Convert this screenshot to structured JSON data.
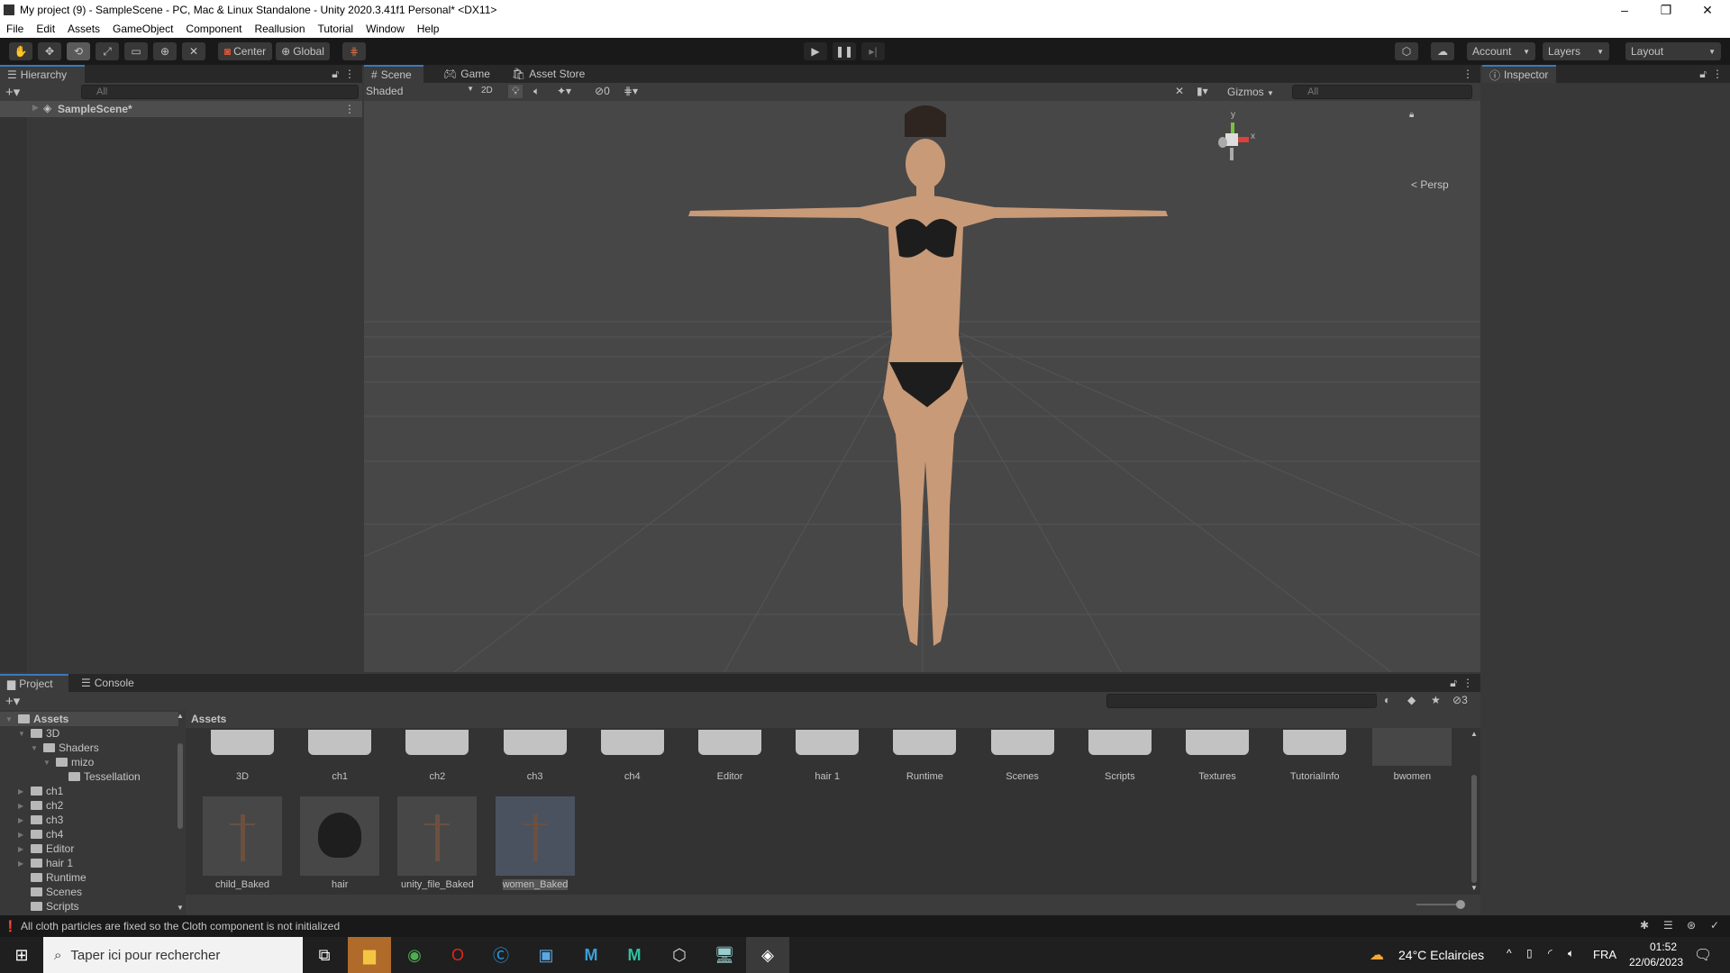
{
  "window": {
    "title": "My project (9) - SampleScene - PC, Mac & Linux Standalone - Unity 2020.3.41f1 Personal* <DX11>"
  },
  "menu": [
    "File",
    "Edit",
    "Assets",
    "GameObject",
    "Component",
    "Reallusion",
    "Tutorial",
    "Window",
    "Help"
  ],
  "toolbar": {
    "pivot": "Center",
    "space": "Global",
    "account": "Account",
    "layers": "Layers",
    "layout": "Layout"
  },
  "hierarchy": {
    "tab": "Hierarchy",
    "search_placeholder": "All",
    "scene": "SampleScene*"
  },
  "scene": {
    "tabs": [
      "Scene",
      "Game",
      "Asset Store"
    ],
    "shading": "Shaded",
    "mode2d": "2D",
    "hidden_count": "0",
    "gizmos": "Gizmos",
    "search_placeholder": "All",
    "projection": "Persp",
    "axis_y": "y",
    "axis_x": "x"
  },
  "inspector": {
    "tab": "Inspector"
  },
  "project": {
    "tabs": [
      "Project",
      "Console"
    ],
    "breadcrumb": "Assets",
    "hidden_count": "3",
    "tree": [
      {
        "label": "Assets",
        "depth": 0,
        "open": true
      },
      {
        "label": "3D",
        "depth": 1,
        "open": true
      },
      {
        "label": "Shaders",
        "depth": 2,
        "open": true
      },
      {
        "label": "mizo",
        "depth": 3,
        "open": true
      },
      {
        "label": "Tessellation",
        "depth": 4
      },
      {
        "label": "ch1",
        "depth": 1,
        "closed": true
      },
      {
        "label": "ch2",
        "depth": 1,
        "closed": true
      },
      {
        "label": "ch3",
        "depth": 1,
        "closed": true
      },
      {
        "label": "ch4",
        "depth": 1,
        "closed": true
      },
      {
        "label": "Editor",
        "depth": 1,
        "closed": true
      },
      {
        "label": "hair 1",
        "depth": 1,
        "closed": true
      },
      {
        "label": "Runtime",
        "depth": 1
      },
      {
        "label": "Scenes",
        "depth": 1
      },
      {
        "label": "Scripts",
        "depth": 1
      }
    ],
    "folders": [
      "3D",
      "ch1",
      "ch2",
      "ch3",
      "ch4",
      "Editor",
      "hair 1",
      "Runtime",
      "Scenes",
      "Scripts",
      "Textures",
      "TutorialInfo",
      "bwomen"
    ],
    "assets": [
      "child_Baked",
      "hair",
      "unity_file_Baked",
      "women_Baked"
    ]
  },
  "status": {
    "message": "All cloth particles are fixed so the Cloth component is not initialized"
  },
  "taskbar": {
    "search_placeholder": "Taper ici pour rechercher",
    "weather": "24°C  Eclaircies",
    "lang": "FRA",
    "time": "01:52",
    "date": "22/06/2023"
  }
}
